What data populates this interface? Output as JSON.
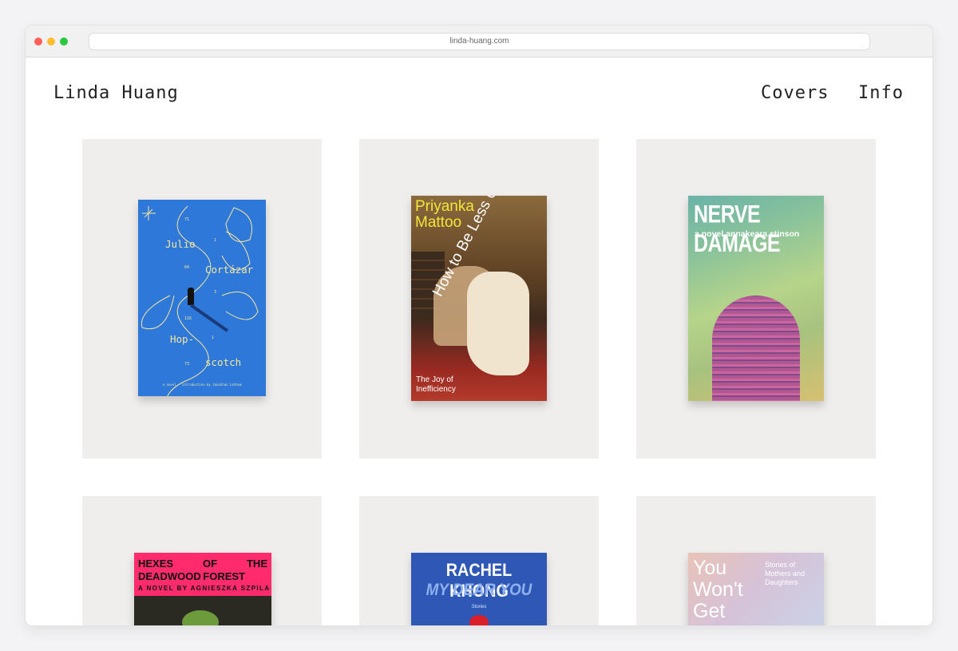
{
  "browser": {
    "url": "linda-huang.com"
  },
  "site": {
    "title": "Linda Huang",
    "nav": {
      "covers": "Covers",
      "info": "Info"
    }
  },
  "books": {
    "hopscotch": {
      "author_first": "Julio",
      "author_last": "Cortázar",
      "title_1": "Hop-",
      "title_2": "scotch",
      "numbers": [
        "71",
        "1",
        "84",
        "3",
        "116",
        "1",
        "73"
      ],
      "tagline": "a novel • introduction by Jonathan Lethem"
    },
    "useful": {
      "author_line1": "Priyanka",
      "author_line2": "Mattoo",
      "title": "How to Be Less Useful",
      "subtitle_line1": "The Joy of",
      "subtitle_line2": "Inefficiency"
    },
    "nerve": {
      "title": "NERVE DAMAGE",
      "subtitle": "a novel   annakeara stinson"
    },
    "hexes": {
      "title_words": [
        "HEXES",
        "OF",
        "THE"
      ],
      "title_line2_a": "DEADWOOD",
      "title_line2_b": "FOREST",
      "subtitle": "A NOVEL BY AGNIESZKA SZPILA"
    },
    "dearyou": {
      "author": "RACHEL KHONG",
      "title": "MY DEAR YOU",
      "label": "Stories"
    },
    "wontget": {
      "title_line1": "You",
      "title_line2": "Won't",
      "title_line3": "Get",
      "sub_1": "Stories of",
      "sub_2": "Mothers and",
      "sub_3": "Daughters"
    }
  },
  "colors": {
    "tile": "#efeeed",
    "hopscotch_blue": "#2d78d8",
    "hexes_pink": "#ff2b6d",
    "dearyou_blue": "#2f57b6"
  }
}
